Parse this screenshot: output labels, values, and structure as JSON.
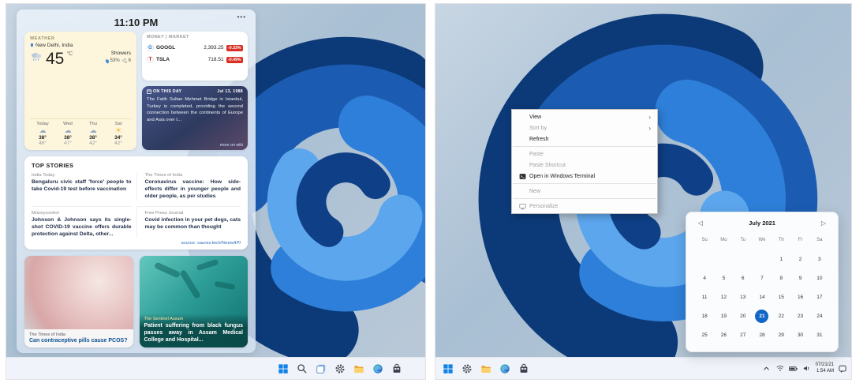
{
  "left_screen": {
    "widgets_panel": {
      "time": "11:10 PM",
      "more_button": "•••",
      "weather": {
        "label": "WEATHER",
        "location": "New Delhi, India",
        "temperature": "45",
        "unit": "°C",
        "condition": "Showers",
        "humidity": "53%",
        "wind_speed": "6",
        "forecast": [
          {
            "day": "Today",
            "icon": "rain-cloud",
            "high": "38°",
            "low": "46°"
          },
          {
            "day": "Wed",
            "icon": "drizzle-cloud",
            "high": "38°",
            "low": "47°"
          },
          {
            "day": "Thu",
            "icon": "cloud",
            "high": "38°",
            "low": "42°"
          },
          {
            "day": "Sat",
            "icon": "sun",
            "high": "34°",
            "low": "42°"
          }
        ]
      },
      "market": {
        "label": "MONEY | MARKET",
        "stocks": [
          {
            "initial": "G",
            "symbol": "GOOGL",
            "price": "2,393.25",
            "change": "-0.33%"
          },
          {
            "initial": "T",
            "symbol": "TSLA",
            "price": "718.51",
            "change": "-0.49%"
          }
        ]
      },
      "on_this_day": {
        "label": "ON THIS DAY",
        "date": "Jul 13, 1988",
        "body": "The Fatih Sultan Mehmet Bridge in Istanbul, Turkey is completed, providing the second connection between the continents of Europe and Asia over t...",
        "link": "more on wiki"
      },
      "top_stories": {
        "title": "TOP STORIES",
        "stories": [
          {
            "source": "India Today",
            "headline": "Bengaluru civic staff 'force' people to take Covid-19 test before vaccination"
          },
          {
            "source": "The Times of India",
            "headline": "Coronavirus vaccine: How side-effects differ in younger people and older people, as per studies"
          },
          {
            "source": "Moneycontrol",
            "headline": "Johnson & Johnson says its single-shot COVID-19 vaccine offers durable protection against Delta, other..."
          },
          {
            "source": "Free Press Journal",
            "headline": "Covid infection in your pet dogs, cats may be common than thought"
          }
        ],
        "attribution": "source: saurav.tech/NewsAPI"
      },
      "news_cards": [
        {
          "source": "The Times of India",
          "headline": "Can contraceptive pills cause PCOS?"
        },
        {
          "source": "The Sentinel Assam",
          "headline": "Patient suffering from black fungus passes away in Assam Medical College and Hospital..."
        }
      ]
    },
    "taskbar": {
      "icons": [
        "start",
        "search",
        "task-view",
        "settings",
        "file-explorer",
        "edge",
        "store"
      ]
    }
  },
  "right_screen": {
    "context_menu": {
      "items": [
        {
          "label": "View",
          "has_submenu": true,
          "enabled": true
        },
        {
          "label": "Sort by",
          "has_submenu": true,
          "enabled": false
        },
        {
          "label": "Refresh",
          "enabled": true
        },
        {
          "label": "Paste",
          "enabled": false
        },
        {
          "label": "Paste Shortcut",
          "enabled": false
        },
        {
          "label": "Open in Windows Terminal",
          "icon": "terminal-icon",
          "enabled": true
        },
        {
          "label": "New",
          "has_submenu": true,
          "enabled": false
        },
        {
          "label": "Personalize",
          "icon": "display-icon",
          "enabled": false
        }
      ]
    },
    "calendar": {
      "prev_arrow": "◁",
      "next_arrow": "▷",
      "title": "July 2021",
      "weekdays": [
        "Su",
        "Mo",
        "Tu",
        "We",
        "Th",
        "Fr",
        "Sa"
      ],
      "cells": [
        "",
        "",
        "",
        "",
        "1",
        "2",
        "3",
        "4",
        "5",
        "6",
        "7",
        "8",
        "9",
        "10",
        "11",
        "12",
        "13",
        "14",
        "15",
        "16",
        "17",
        "18",
        "19",
        "20",
        "21",
        "22",
        "23",
        "24",
        "25",
        "26",
        "27",
        "28",
        "29",
        "30",
        "31"
      ],
      "selected_day": "21"
    },
    "taskbar": {
      "icons": [
        "start",
        "settings",
        "file-explorer",
        "edge",
        "store"
      ],
      "tray": {
        "date": "07/21/21",
        "time": "1:54 AM"
      }
    }
  },
  "colors": {
    "accent_blue": "#1266c6",
    "negative_red": "#d93025",
    "taskbar_bg": "#f0f4fa",
    "weather_card_bg": "#fdf6dd"
  }
}
